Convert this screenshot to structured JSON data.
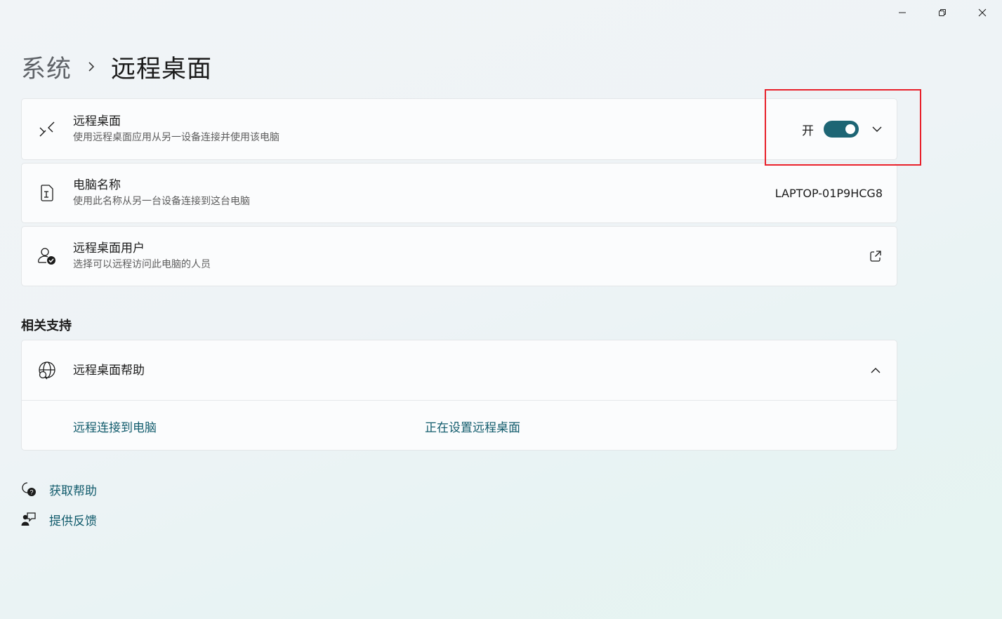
{
  "window": {
    "controls": {
      "minimize": "minimize-icon",
      "maximize": "restore-icon",
      "close": "close-icon"
    }
  },
  "breadcrumb": {
    "parent": "系统",
    "separator_icon": "chevron-right-icon",
    "current": "远程桌面"
  },
  "settings": {
    "remote_desktop": {
      "icon": "remote-desktop-icon",
      "title": "远程桌面",
      "subtitle": "使用远程桌面应用从另一设备连接并使用该电脑",
      "toggle_label": "开",
      "toggle_state": "on"
    },
    "pc_name": {
      "icon": "pc-name-icon",
      "title": "电脑名称",
      "subtitle": "使用此名称从另一台设备连接到这台电脑",
      "value": "LAPTOP-01P9HCG8"
    },
    "remote_users": {
      "icon": "user-check-icon",
      "title": "远程桌面用户",
      "subtitle": "选择可以远程访问此电脑的人员"
    }
  },
  "related_support": {
    "heading": "相关支持",
    "help": {
      "icon": "globe-search-icon",
      "title": "远程桌面帮助",
      "links": [
        "远程连接到电脑",
        "正在设置远程桌面"
      ]
    }
  },
  "footer": {
    "get_help": "获取帮助",
    "feedback": "提供反馈"
  },
  "colors": {
    "accent": "#1d6574",
    "link": "#115b6c",
    "highlight": "#e8202a"
  }
}
